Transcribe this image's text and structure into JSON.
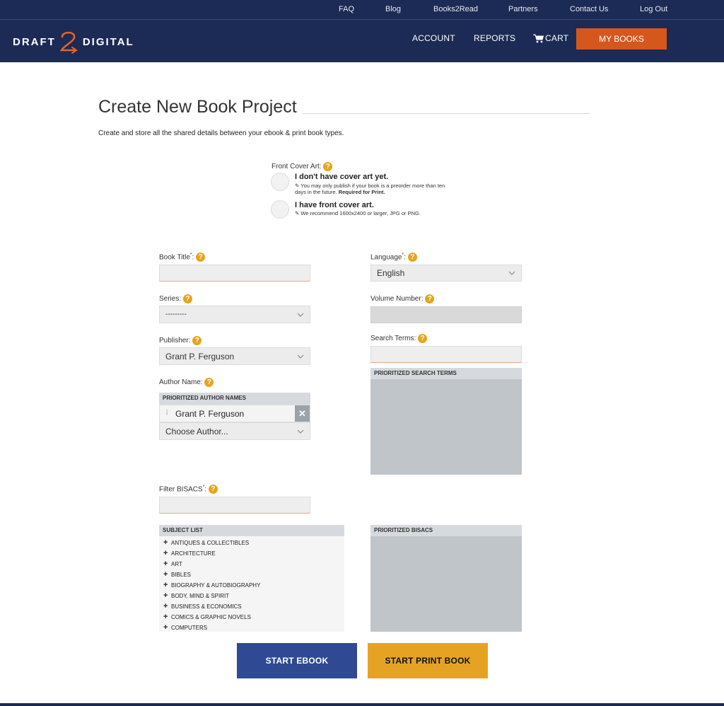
{
  "topbar": {
    "links": [
      "FAQ",
      "Blog",
      "Books2Read",
      "Partners",
      "Contact Us",
      "Log Out"
    ]
  },
  "nav": {
    "logo_left": "DRAFT",
    "logo_right": "DIGITAL",
    "account": "ACCOUNT",
    "reports": "REPORTS",
    "cart": "CART",
    "my_books": "MY BOOKS",
    "brand_color": "#1c2b55",
    "accent_color": "#d4571e"
  },
  "page": {
    "title": "Create New Book Project",
    "subtitle": "Create and store all the shared details between your ebook & print book types."
  },
  "cover_art": {
    "label": "Front Cover Art:",
    "option1_title": "I don't have cover art yet.",
    "option1_note": "You may only publish if your book is a preorder more than ten days in the future.",
    "option1_note_bold": "Required for Print.",
    "option2_title": "I have front cover art.",
    "option2_note": "We recommend 1600x2400 or larger, JPG or PNG."
  },
  "form": {
    "book_title_label": "Book Title",
    "language_label": "Language",
    "language_value": "English",
    "series_label": "Series:",
    "series_value": "---------",
    "volume_label": "Volume Number:",
    "publisher_label": "Publisher:",
    "publisher_value": "Grant P. Ferguson",
    "search_terms_label": "Search Terms:",
    "prioritized_search_terms": "PRIORITIZED SEARCH TERMS",
    "author_label": "Author Name:",
    "prioritized_author_names": "PRIORITIZED AUTHOR NAMES",
    "author_value": "Grant P. Ferguson",
    "choose_author": "Choose Author...",
    "filter_bisacs_label": "Filter BISACS",
    "subject_list_header": "SUBJECT LIST",
    "prioritized_bisacs": "PRIORITIZED BISACS",
    "subjects": [
      "ANTIQUES & COLLECTIBLES",
      "ARCHITECTURE",
      "ART",
      "BIBLES",
      "BIOGRAPHY & AUTOBIOGRAPHY",
      "BODY, MIND & SPIRIT",
      "BUSINESS & ECONOMICS",
      "COMICS & GRAPHIC NOVELS",
      "COMPUTERS"
    ]
  },
  "buttons": {
    "start_ebook": "START EBOOK",
    "start_print": "START PRINT BOOK"
  },
  "icons": {
    "help": "question-mark-circle-icon",
    "cart": "shopping-cart-icon",
    "edit": "edit-note-icon",
    "chevron": "chevron-down-icon",
    "remove": "close-icon",
    "expand": "plus-icon"
  }
}
